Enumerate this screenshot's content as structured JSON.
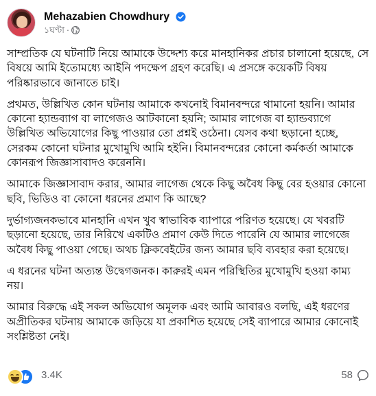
{
  "author": {
    "name": "Mehazabien Chowdhury",
    "verified": true
  },
  "meta": {
    "time": "১ঘণ্টা",
    "separator": "·",
    "audience_icon": "globe-icon"
  },
  "post": {
    "paragraphs": [
      "সাম্প্রতিক যে ঘটনাটি নিয়ে আমাকে উদ্দেশ্য করে মানহানিকর প্রচার চালানো হয়েছে, সে বিষয়ে আমি ইতোমধ্যে আইনি পদক্ষেপ গ্রহণ করেছি। এ প্রসঙ্গে কয়েকটি বিষয় পরিষ্কারভাবে জানাতে চাই।",
      "প্রথমত, উল্লিখিত কোন ঘটনায় আমাকে কখনোই বিমানবন্দরে থামানো হয়নি। আমার কোনো হ্যান্ডব্যাগ বা লাগেজও আটকানো হয়নি; আমার লাগেজ বা হ্যান্ডব্যাগে উল্লিখিত অভিযোগের কিছু পাওয়ার তো প্রশ্নই ওঠেনা। যেসব কথা ছড়ানো হচ্ছে, সেরকম কোনো ঘটনার মুখোমুখি আমি হইনি। বিমানবন্দরের কোনো কর্মকর্তা আমাকে কোনরূপ জিজ্ঞাসাবাদও করেননি।",
      "আমাকে জিজ্ঞাসাবাদ করার, আমার লাগেজ থেকে কিছু অবৈধ কিছু বের হওয়ার কোনো ছবি, ভিডিও বা কোনো ধরনের প্রমাণ কি আছে?",
      "দুর্ভাগ্যজনকভাবে মানহানি এখন খুব স্বাভাবিক ব্যাপারে পরিণত হয়েছে। যে খবরটি ছড়ানো হয়েছে, তার নিরিখে একটিও প্রমাণ কেউ দিতে পারেনি যে আমার লাগেজে অবৈধ কিছু পাওয়া গেছে। অথচ ক্লিকবেইটের জন্য আমার ছবি ব্যবহার করা হয়েছে।",
      "এ ধরনের ঘটনা অত্যন্ত উদ্বেগজনক। কারুরই এমন পরিস্থিতির মুখোমুখি হওয়া কাম্য নয়।",
      "আমার বিরুদ্ধে এই সকল অভিযোগ অমূলক এবং আমি আবারও বলছি, এই ধরণের অপ্রীতিকর ঘটনায় আমাকে জড়িয়ে যা প্রকাশিত হয়েছে সেই ব্যাপারে আমার কোনোই সংশ্লিষ্টতা নেই।"
    ]
  },
  "footer": {
    "reactions": [
      "haha-icon",
      "like-icon"
    ],
    "reaction_count": "3.4K",
    "comment_count": "58",
    "comment_icon": "comment-icon"
  },
  "colors": {
    "verified": "#1877f2",
    "secondary_text": "#65676b",
    "like": "#1877f2",
    "haha": "#f7d35a"
  }
}
